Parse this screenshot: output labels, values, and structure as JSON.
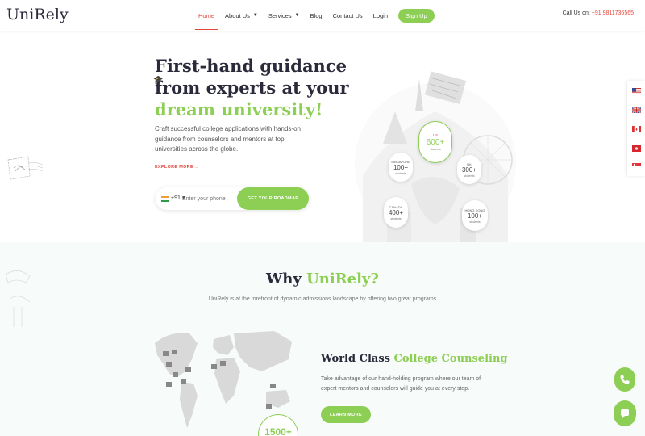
{
  "brand": {
    "logo": "UniRely",
    "accent": "#8dcf55",
    "red": "#e2453c"
  },
  "nav": {
    "items": [
      {
        "label": "Home",
        "active": true
      },
      {
        "label": "About Us",
        "dropdown": true
      },
      {
        "label": "Services",
        "dropdown": true
      },
      {
        "label": "Blog"
      },
      {
        "label": "Contact Us"
      },
      {
        "label": "Login"
      }
    ],
    "signup": "Sign Up",
    "call_label": "Call Us on: ",
    "call_number": "+91 9811736565"
  },
  "hero": {
    "title_part1": "First-hand guidance from experts at your ",
    "title_part2": "dream university!",
    "paragraph": "Craft successful college applications with hands-on guidance from counselors and mentors at top universities across the globe.",
    "explore": "EXPLORE MORE →",
    "phone_code": "+91 ▾",
    "phone_placeholder": "Enter your phone",
    "cta": "GET YOUR ROADMAP",
    "bubbles": [
      {
        "country": "US",
        "count": "600+",
        "sub": "students",
        "big": true
      },
      {
        "country": "SINGAPORE",
        "count": "100+",
        "sub": "students"
      },
      {
        "country": "UK",
        "count": "300+",
        "sub": "students"
      },
      {
        "country": "CANADA",
        "count": "400+",
        "sub": "students"
      },
      {
        "country": "HONG KONG",
        "count": "100+",
        "sub": "students"
      }
    ]
  },
  "flags": [
    "us-flag",
    "uk-flag",
    "canada-flag",
    "hong-kong-flag",
    "singapore-flag"
  ],
  "why": {
    "title_part1": "Why ",
    "title_part2": "UniRely?",
    "subtitle": "UniRely is at the forefront of dynamic admissions landscape by offering two great programs",
    "card_title_part1": "World Class ",
    "card_title_part2": "College Counseling",
    "card_text": "Take advantage of our hand-holding program where our team of expert mentors and counselors will guide you at every step.",
    "learn": "LEARN MORE",
    "map_count": "1500+"
  }
}
